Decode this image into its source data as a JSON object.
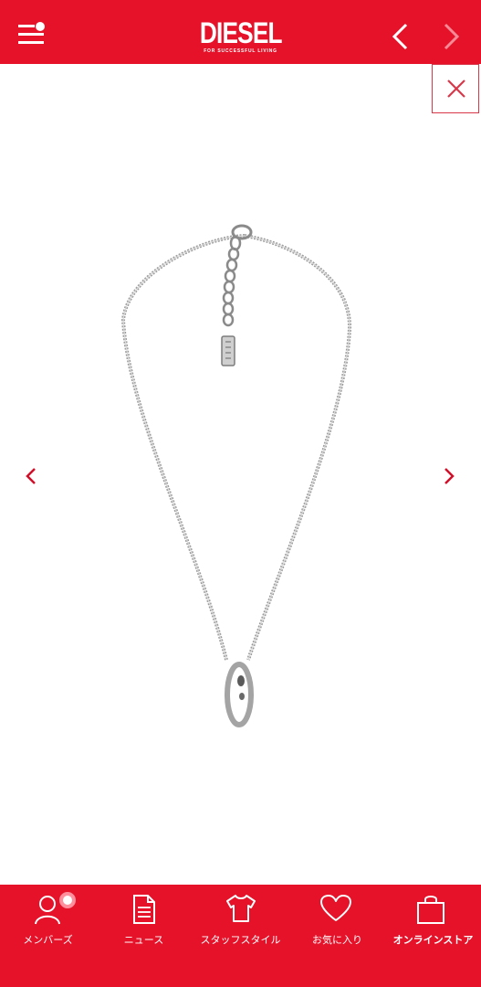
{
  "header": {
    "brand": "DIESEL",
    "tagline": "FOR SUCCESSFUL LIVING",
    "menu_icon": "menu-with-dot-icon",
    "prev_icon": "chevron-left-icon",
    "next_icon": "chevron-right-icon"
  },
  "viewer": {
    "close_icon": "close-icon",
    "gallery_prev_icon": "chevron-left-icon",
    "gallery_next_icon": "chevron-right-icon",
    "product_image": "silver-chain-necklace-with-ring-pendant"
  },
  "tabbar": {
    "tabs": [
      {
        "label": "メンバーズ",
        "icon": "person-icon",
        "has_badge": true
      },
      {
        "label": "ニュース",
        "icon": "document-icon"
      },
      {
        "label": "スタッフスタイル",
        "icon": "tshirt-icon"
      },
      {
        "label": "お気に入り",
        "icon": "heart-icon"
      },
      {
        "label": "オンラインストア",
        "icon": "shopping-bag-icon",
        "active": true
      }
    ]
  },
  "colors": {
    "brand_red": "#e5122a",
    "icon_white": "#ffffff",
    "badge_ring": "#ff8f9c",
    "chevron_red": "#d0102a"
  }
}
